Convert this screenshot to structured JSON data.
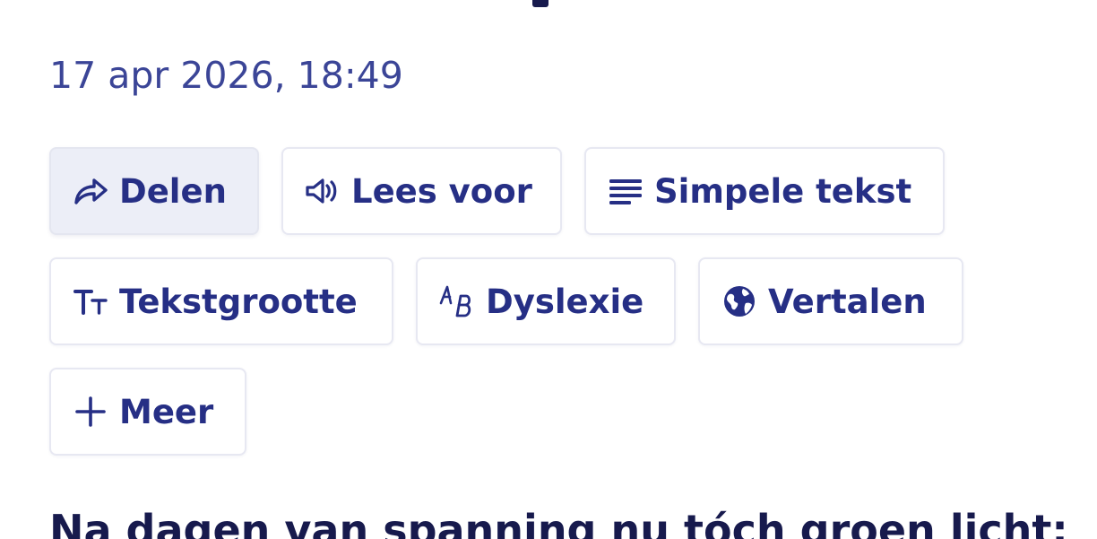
{
  "article": {
    "date": "17 apr 2026, 18:49",
    "headline": "Na dagen van spanning nu tóch groen licht:"
  },
  "toolbar": {
    "buttons": [
      {
        "label": "Delen",
        "icon": "share-icon",
        "active": true
      },
      {
        "label": "Lees voor",
        "icon": "speaker-icon",
        "active": false
      },
      {
        "label": "Simpele tekst",
        "icon": "text-lines-icon",
        "active": false
      },
      {
        "label": "Tekstgrootte",
        "icon": "text-size-icon",
        "active": false
      },
      {
        "label": "Dyslexie",
        "icon": "dyslexia-icon",
        "active": false
      },
      {
        "label": "Vertalen",
        "icon": "globe-icon",
        "active": false
      },
      {
        "label": "Meer",
        "icon": "plus-icon",
        "active": false
      }
    ]
  },
  "colors": {
    "accent": "#262f85",
    "date_text": "#3b4597",
    "headline": "#171a4d",
    "active_bg": "#eceef7",
    "border": "#e7e8f2"
  }
}
